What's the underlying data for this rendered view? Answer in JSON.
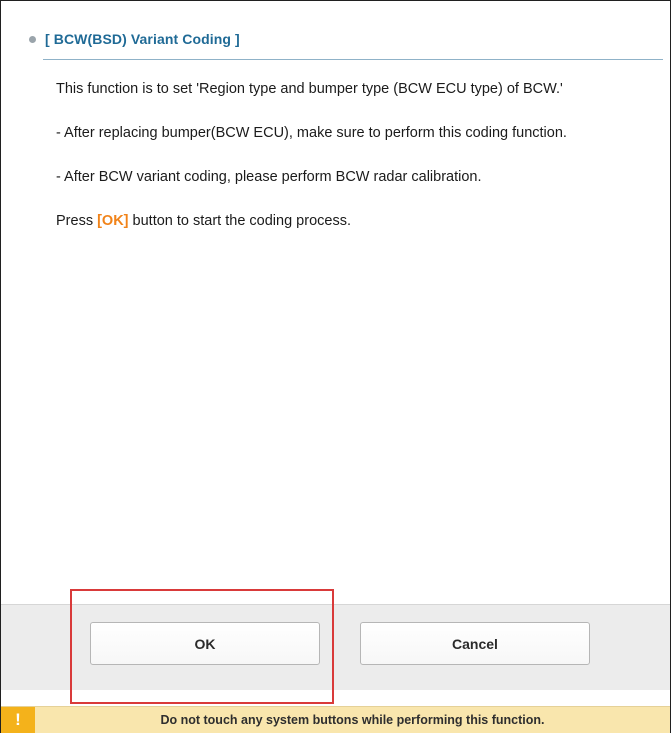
{
  "dialog": {
    "title": "[ BCW(BSD) Variant Coding ]",
    "paragraphs": [
      "This function is to set 'Region type and bumper type (BCW ECU type) of BCW.'",
      "- After replacing bumper(BCW ECU), make sure to perform this coding function.",
      "- After BCW variant coding, please perform BCW radar calibration."
    ],
    "instruction": {
      "prefix": "Press ",
      "ok_label": "[OK]",
      "suffix": " button to start the coding process."
    }
  },
  "buttons": {
    "ok": "OK",
    "cancel": "Cancel"
  },
  "warning": {
    "icon": "!",
    "text": "Do not touch any system buttons while performing this function."
  },
  "colors": {
    "title": "#1f6a96",
    "accent_ok": "#f18319",
    "highlight_box": "#d93a3a",
    "warning_bg": "#f9e6ad",
    "warning_icon_bg": "#f4b21b"
  }
}
